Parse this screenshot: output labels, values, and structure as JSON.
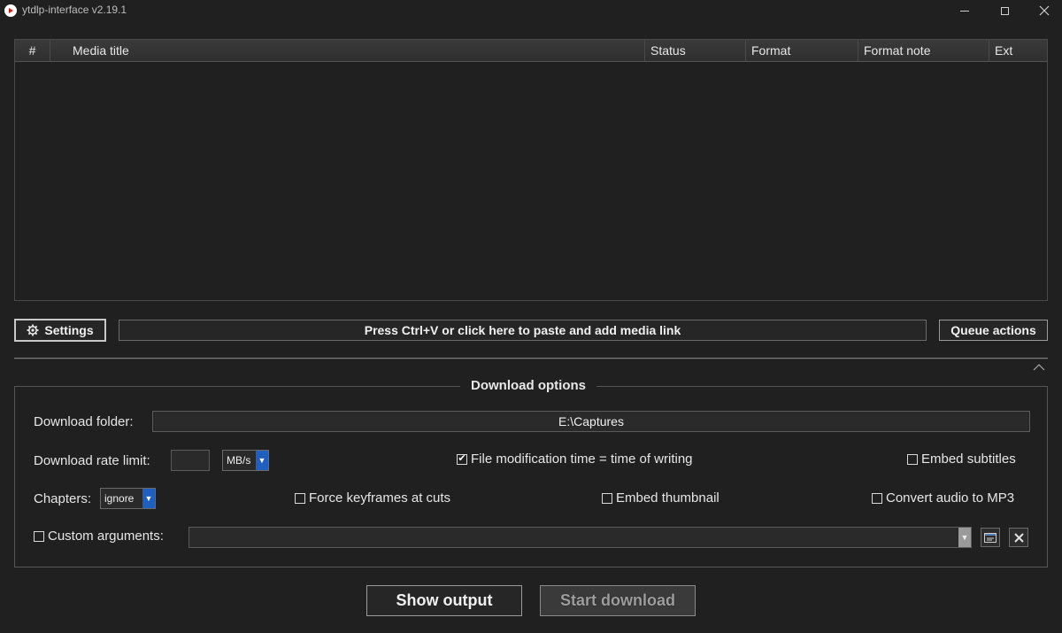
{
  "window": {
    "title": "ytdlp-interface v2.19.1",
    "icons": {
      "app": "youtube-play-icon",
      "minimize": "minimize-icon",
      "maximize": "maximize-icon",
      "close": "close-icon"
    }
  },
  "queue_table": {
    "columns": [
      "#",
      "Media title",
      "Status",
      "Format",
      "Format note",
      "Ext"
    ],
    "rows": []
  },
  "toolbar": {
    "settings_label": "Settings",
    "settings_icon": "gear-icon",
    "paste_label": "Press Ctrl+V or click here to paste and add media link",
    "queue_actions_label": "Queue actions"
  },
  "download_options": {
    "title": "Download options",
    "collapse_icon": "chevron-up-icon",
    "folder_label": "Download folder:",
    "folder_value": "E:\\Captures",
    "rate_label": "Download rate limit:",
    "rate_value": "",
    "rate_unit": "MB/s",
    "file_mod_time_label": "File modification time = time of writing",
    "file_mod_time_checked": true,
    "embed_subtitles_label": "Embed subtitles",
    "embed_subtitles_checked": false,
    "chapters_label": "Chapters:",
    "chapters_value": "ignore",
    "force_keyframes_label": "Force keyframes at cuts",
    "force_keyframes_checked": false,
    "embed_thumbnail_label": "Embed thumbnail",
    "embed_thumbnail_checked": false,
    "convert_mp3_label": "Convert audio to MP3",
    "convert_mp3_checked": false,
    "custom_args_label": "Custom arguments:",
    "custom_args_checked": false,
    "custom_args_value": ""
  },
  "actions": {
    "show_output_label": "Show output",
    "start_download_label": "Start download"
  },
  "colors": {
    "accent": "#1f5fbf",
    "background": "#202020"
  }
}
